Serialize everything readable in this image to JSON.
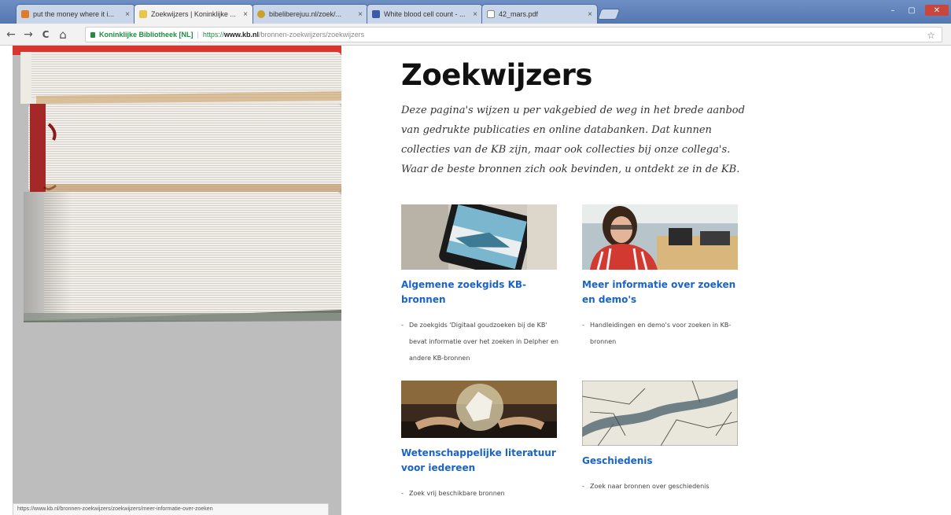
{
  "browser": {
    "tabs": [
      {
        "title": "put the money where it i...",
        "favicon_color": "#e07b2b",
        "active": false
      },
      {
        "title": "Zoekwijzers | Koninklijke ...",
        "favicon_color": "#e9c54d",
        "active": true
      },
      {
        "title": "bibeliberejuu.nl/zoek/...",
        "favicon_color": "#c7a12c",
        "active": false
      },
      {
        "title": "White blood cell count - ...",
        "favicon_color": "#3b5aa8",
        "active": false
      },
      {
        "title": "42_mars.pdf",
        "favicon_color": "#ffffff",
        "active": false
      }
    ],
    "close_glyph": "×",
    "back_icon": "←",
    "forward_icon": "→",
    "reload_icon": "C",
    "home_icon": "⌂",
    "site_identity": "Koninklijke Bibliotheek [NL]",
    "url_scheme": "https://",
    "url_host": "www.kb.nl",
    "url_path": "/bronnen-zoekwijzers/zoekwijzers",
    "separator": "|",
    "star_icon": "☆",
    "window_controls": [
      "–",
      "▢",
      "✕"
    ]
  },
  "page": {
    "title": "Zoekwijzers",
    "intro": "Deze pagina's wijzen u per vakgebied de weg in het brede aanbod van gedrukte publicaties en online databanken. Dat kunnen collecties van de KB zijn, maar ook collecties bij onze collega's. Waar de beste bronnen zich ook bevinden, u ontdekt ze in de KB.",
    "cards": [
      {
        "title": "Algemene zoekgids KB-bronnen",
        "bullet": "De zoekgids 'Digitaal goudzoeken bij de KB' bevat informatie over het zoeken in Delpher en andere KB-bronnen"
      },
      {
        "title": "Meer informatie over zoeken en demo's",
        "bullet": "Handleidingen en demo's voor zoeken in KB-bronnen"
      },
      {
        "title": "Wetenschappelijke literatuur voor iedereen",
        "bullet": "Zoek vrij beschikbare bronnen"
      },
      {
        "title": "Geschiedenis",
        "bullet": "Zoek naar bronnen over geschiedenis"
      }
    ]
  },
  "statusbar": {
    "text": "https://www.kb.nl/bronnen-zoekwijzers/zoekwijzers/meer-informatie-over-zoeken"
  },
  "colors": {
    "link": "#1a63c7",
    "secure": "#1e8e3e",
    "hero_background": "#bdbdbd"
  }
}
